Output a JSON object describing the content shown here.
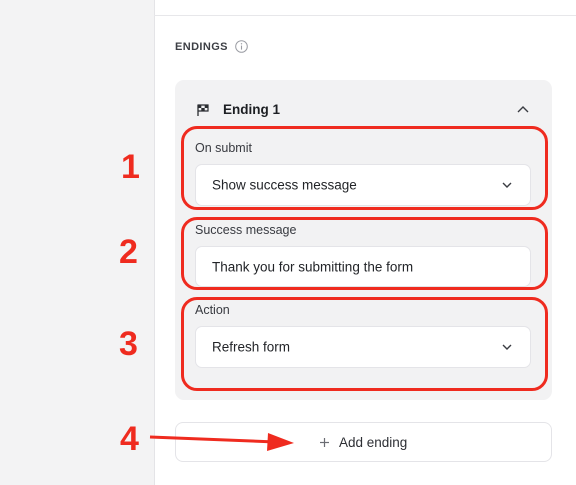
{
  "section": {
    "title": "ENDINGS",
    "info_icon": "info-circle-icon"
  },
  "ending": {
    "title": "Ending 1",
    "flag_icon": "flag-icon",
    "collapse_icon": "chevron-up-icon",
    "fields": {
      "on_submit": {
        "label": "On submit",
        "value": "Show success message"
      },
      "success_message": {
        "label": "Success message",
        "value": "Thank you for submitting the form"
      },
      "action": {
        "label": "Action",
        "value": "Refresh form"
      }
    }
  },
  "add_ending": {
    "label": "Add ending",
    "icon": "plus-icon"
  },
  "annotations": {
    "color": "#ef2b1f",
    "numbers": [
      "1",
      "2",
      "3",
      "4"
    ]
  }
}
